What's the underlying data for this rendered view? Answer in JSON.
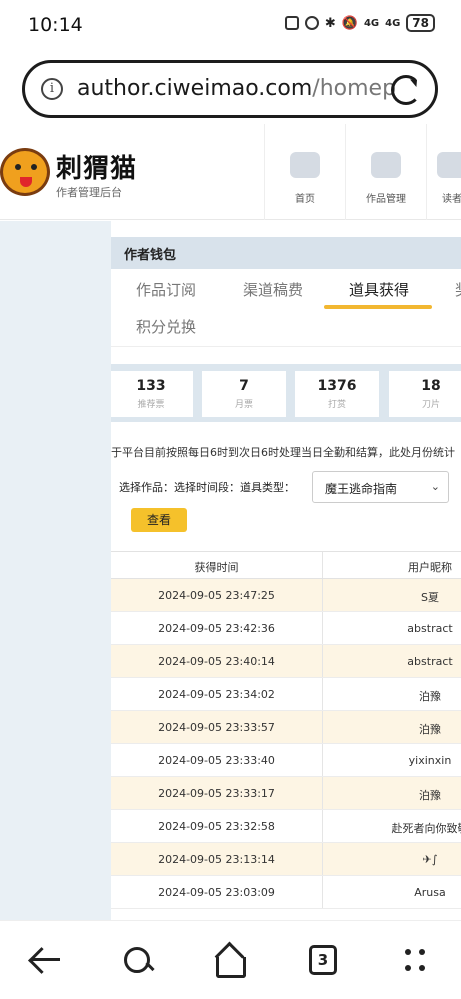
{
  "status_bar": {
    "time": "10:14",
    "signal_1": "4G",
    "signal_2": "4G",
    "battery": "78"
  },
  "browser": {
    "url_main": "author.ciweimao.com",
    "url_rest": "/homep",
    "icons": [
      "info-icon",
      "reload-icon"
    ]
  },
  "site_header": {
    "logo_title": "刺猬猫",
    "logo_subtitle": "作者管理后台",
    "nav": [
      {
        "label": "首页",
        "icon": "home-icon"
      },
      {
        "label": "作品管理",
        "icon": "book-icon"
      },
      {
        "label": "读者",
        "icon": "reader-icon"
      }
    ]
  },
  "wallet": {
    "title": "作者钱包",
    "tabs": [
      {
        "label": "作品订阅"
      },
      {
        "label": "渠道稿费"
      },
      {
        "label": "道具获得",
        "active": true
      },
      {
        "label": "奖"
      },
      {
        "label": "积分兑换"
      }
    ],
    "stats": [
      {
        "value": "133",
        "label": "推荐票"
      },
      {
        "value": "7",
        "label": "月票"
      },
      {
        "value": "1376",
        "label": "打赏"
      },
      {
        "value": "18",
        "label": "刀片"
      }
    ],
    "notice": "于平台目前按照每日6时到次日6时处理当日全勤和结算，此处月份统计",
    "filter": {
      "label": "选择作品：选择时间段：道具类型：",
      "select_value": "魔王逃命指南",
      "button": "查看"
    },
    "table": {
      "headers": [
        "获得时间",
        "用户昵称"
      ],
      "rows": [
        {
          "time": "2024-09-05 23:47:25",
          "user": "S夏"
        },
        {
          "time": "2024-09-05 23:42:36",
          "user": "abstract"
        },
        {
          "time": "2024-09-05 23:40:14",
          "user": "abstract"
        },
        {
          "time": "2024-09-05 23:34:02",
          "user": "泊豫"
        },
        {
          "time": "2024-09-05 23:33:57",
          "user": "泊豫"
        },
        {
          "time": "2024-09-05 23:33:40",
          "user": "yixinxin"
        },
        {
          "time": "2024-09-05 23:33:17",
          "user": "泊豫"
        },
        {
          "time": "2024-09-05 23:32:58",
          "user": "赴死者向你致敬"
        },
        {
          "time": "2024-09-05 23:13:14",
          "user": "✈∫"
        },
        {
          "time": "2024-09-05 23:03:09",
          "user": "Arusa"
        }
      ]
    }
  },
  "bottom_nav": {
    "tab_count": "3",
    "icons": [
      "back-icon",
      "search-icon",
      "home-icon",
      "tabs-icon",
      "menu-icon"
    ]
  },
  "colors": {
    "accent": "#f5c12b",
    "tab_underline": "#f2b731",
    "row_highlight": "#fdf5e4",
    "sidebar_bg": "#e9f0f5",
    "header_bg": "#d8e2eb"
  }
}
